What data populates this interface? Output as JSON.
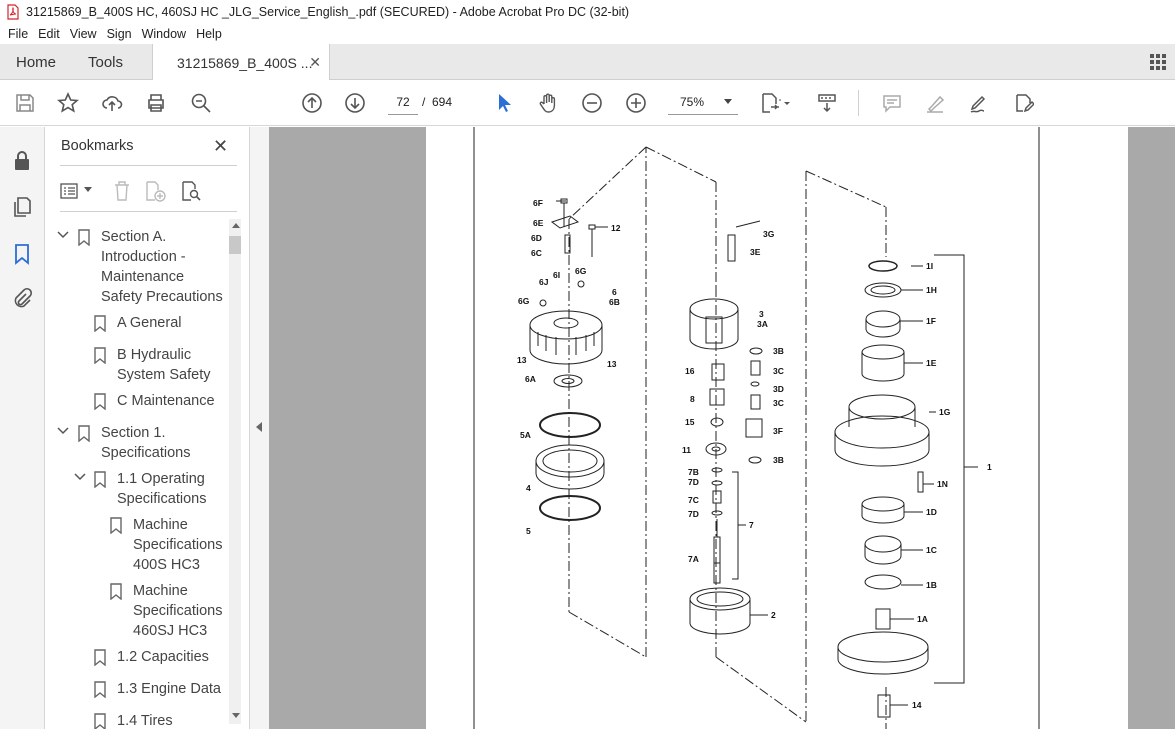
{
  "window": {
    "title": "31215869_B_400S HC, 460SJ HC _JLG_Service_English_.pdf (SECURED) - Adobe Acrobat Pro DC (32-bit)"
  },
  "menu": [
    "File",
    "Edit",
    "View",
    "Sign",
    "Window",
    "Help"
  ],
  "tabs": {
    "home": "Home",
    "tools": "Tools",
    "document": "31215869_B_400S ..."
  },
  "toolbar": {
    "current_page": "72",
    "page_separator": "/",
    "total_pages": "694",
    "zoom": "75%"
  },
  "icons": {
    "titlebar": "pdf-icon",
    "tabbar": [
      "close-icon",
      "apps-grid-icon"
    ],
    "toolbar": [
      "save-icon",
      "bookmark-star-icon",
      "upload-icon",
      "print-icon",
      "zoom-search-icon",
      "page-up-icon",
      "page-down-icon",
      "select-arrow-icon",
      "hand-tool-icon",
      "zoom-out-icon",
      "zoom-in-icon",
      "page-fit-icon",
      "scroll-mode-icon",
      "comment-icon",
      "highlight-icon",
      "sign-icon",
      "fill-sign-icon"
    ],
    "rail": [
      "lock-icon",
      "pages-icon",
      "bookmark-icon",
      "attachment-icon"
    ]
  },
  "bookmarks": {
    "header": "Bookmarks",
    "items": [
      {
        "label_lines": [
          "Section A.",
          "Introduction -",
          "Maintenance",
          "Safety Precautions"
        ],
        "expanded": true
      },
      {
        "label_lines": [
          "A General"
        ]
      },
      {
        "label_lines": [
          "B Hydraulic",
          "System Safety"
        ]
      },
      {
        "label_lines": [
          "C Maintenance"
        ]
      },
      {
        "label_lines": [
          "Section 1.",
          "Specifications"
        ],
        "expanded": true
      },
      {
        "label_lines": [
          "1.1 Operating",
          "Specifications"
        ],
        "expanded": true
      },
      {
        "label_lines": [
          "Machine",
          "Specifications",
          "400S HC3"
        ]
      },
      {
        "label_lines": [
          "Machine",
          "Specifications",
          "460SJ HC3"
        ]
      },
      {
        "label_lines": [
          "1.2 Capacities"
        ]
      },
      {
        "label_lines": [
          "1.3 Engine Data"
        ]
      },
      {
        "label_lines": [
          "1.4 Tires"
        ]
      }
    ]
  },
  "diagram": {
    "callouts": [
      "6F",
      "6E",
      "12",
      "6D",
      "6C",
      "6I",
      "6G",
      "6J",
      "6",
      "6G",
      "6B",
      "13",
      "13",
      "6A",
      "5A",
      "4",
      "5",
      "3G",
      "3E",
      "3",
      "3A",
      "3B",
      "16",
      "3C",
      "3D",
      "3C",
      "8",
      "3F",
      "15",
      "11",
      "3B",
      "7B",
      "7D",
      "7C",
      "7D",
      "7",
      "7A",
      "2",
      "1I",
      "1H",
      "1F",
      "1E",
      "1G",
      "1",
      "1N",
      "1D",
      "1C",
      "1B",
      "1A",
      "14"
    ]
  }
}
